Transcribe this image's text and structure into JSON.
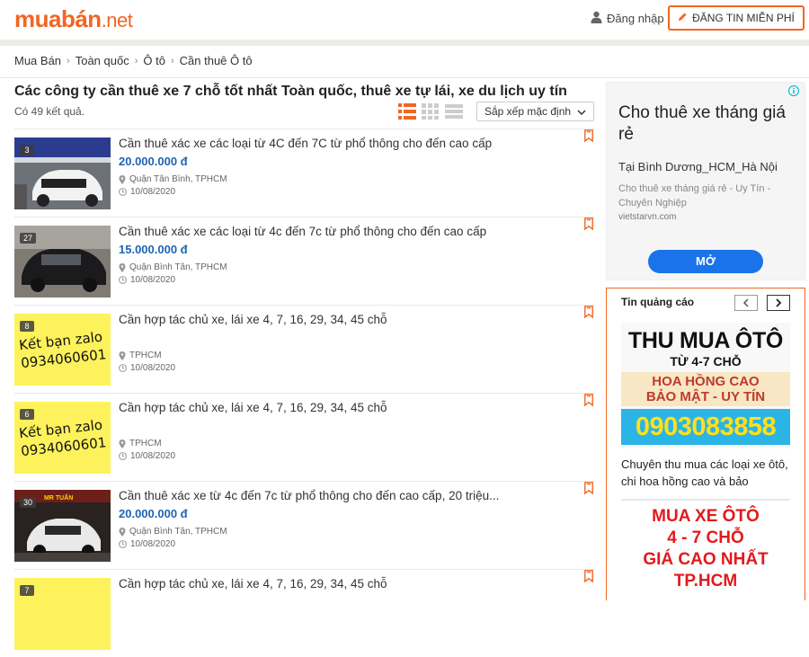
{
  "header": {
    "logo_main": "muabán",
    "logo_tld": ".net",
    "login_label": "Đăng nhập",
    "post_label": "ĐĂNG TIN MIỄN PHÍ",
    "brand_color": "#f26522"
  },
  "breadcrumb": [
    "Mua Bán",
    "Toàn quốc",
    "Ô tô",
    "Cần thuê Ô tô"
  ],
  "page": {
    "title": "Các công ty cần thuê xe 7 chỗ tốt nhất Toàn quốc, thuê xe tự lái, xe du lịch uy tín",
    "result_count": "Có 49 kết quả.",
    "sort_label": "Sắp xếp mặc định"
  },
  "listings": [
    {
      "title": "Cần thuê xác xe các loại từ 4C đến 7C từ phổ thông cho đến cao cấp",
      "price": "20.000.000 đ",
      "location": "Quận Tân Bình, TPHCM",
      "date": "10/08/2020",
      "photos": "3",
      "thumb": "car-white"
    },
    {
      "title": "Cần thuê xác xe các loại từ 4c đến 7c từ phổ thông cho đến cao cấp",
      "price": "15.000.000 đ",
      "location": "Quận Bình Tân, TPHCM",
      "date": "10/08/2020",
      "photos": "27",
      "thumb": "car-black"
    },
    {
      "title": "Cần hợp tác chủ xe, lái xe 4, 7, 16, 29, 34, 45 chỗ",
      "price": "",
      "location": "TPHCM",
      "date": "10/08/2020",
      "photos": "8",
      "thumb": "zalo",
      "thumb_text1": "Kết bạn zalo",
      "thumb_text2": "0934060601"
    },
    {
      "title": "Cần hợp tác chủ xe, lái xe 4, 7, 16, 29, 34, 45 chỗ",
      "price": "",
      "location": "TPHCM",
      "date": "10/08/2020",
      "photos": "6",
      "thumb": "zalo",
      "thumb_text1": "Kết bạn zalo",
      "thumb_text2": "0934060601"
    },
    {
      "title": "Cần thuê xác xe từ 4c đến 7c từ phổ thông cho đến cao cấp, 20 triệu...",
      "price": "20.000.000 đ",
      "location": "Quận Bình Tân, TPHCM",
      "date": "10/08/2020",
      "photos": "30",
      "thumb": "car-show",
      "thumb_text1": "MR TUẤN"
    },
    {
      "title": "Cần hợp tác chủ xe, lái xe 4, 7, 16, 29, 34, 45 chỗ",
      "price": "",
      "location": "",
      "date": "",
      "photos": "7",
      "thumb": "zalo",
      "thumb_text1": "",
      "thumb_text2": ""
    }
  ],
  "ad_google": {
    "headline": "Cho thuê xe tháng giá rẻ",
    "subline": "Tại Bình Dương_HCM_Hà Nội",
    "desc": "Cho thuê xe tháng giá rẻ - Uy Tín - Chuyên Nghiệp",
    "url": "vietstarvn.com",
    "button": "MỞ"
  },
  "ad_box": {
    "heading": "Tin quảng cáo",
    "banner1": {
      "line1": "THU MUA ÔTÔ",
      "line2": "TỪ 4-7 CHỖ",
      "line3": "HOA HỒNG CAO",
      "line4": "BẢO MẬT - UY TÍN",
      "phone": "0903083858"
    },
    "caption": "Chuyên thu mua các loại xe ôtô, chi hoa hồng cao và bảo",
    "banner2": {
      "line1": "MUA XE ÔTÔ",
      "line2": "4 - 7 CHỖ",
      "line3": "GIÁ CAO NHẤT",
      "line4": "TP.HCM"
    }
  }
}
